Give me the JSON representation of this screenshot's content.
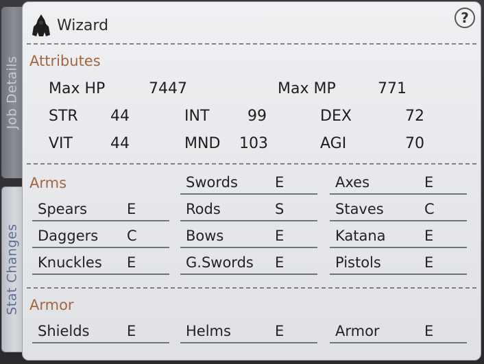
{
  "tabs": {
    "job_details": "Job Details",
    "stat_changes": "Stat Changes"
  },
  "job": {
    "name": "Wizard",
    "icon": "wizard-icon",
    "help": "?"
  },
  "attributes": {
    "title": "Attributes",
    "max_hp_label": "Max HP",
    "max_hp": "7447",
    "max_mp_label": "Max MP",
    "max_mp": "771",
    "str_label": "STR",
    "str": "44",
    "int_label": "INT",
    "int": "99",
    "dex_label": "DEX",
    "dex": "72",
    "vit_label": "VIT",
    "vit": "44",
    "mnd_label": "MND",
    "mnd": "103",
    "agi_label": "AGI",
    "agi": "70"
  },
  "arms": {
    "title": "Arms",
    "items": [
      {
        "name": "Swords",
        "rank": "E"
      },
      {
        "name": "Axes",
        "rank": "E"
      },
      {
        "name": "Spears",
        "rank": "E"
      },
      {
        "name": "Rods",
        "rank": "S"
      },
      {
        "name": "Staves",
        "rank": "C"
      },
      {
        "name": "Daggers",
        "rank": "C"
      },
      {
        "name": "Bows",
        "rank": "E"
      },
      {
        "name": "Katana",
        "rank": "E"
      },
      {
        "name": "Knuckles",
        "rank": "E"
      },
      {
        "name": "G.Swords",
        "rank": "E"
      },
      {
        "name": "Pistols",
        "rank": "E"
      }
    ]
  },
  "armor": {
    "title": "Armor",
    "items": [
      {
        "name": "Shields",
        "rank": "E"
      },
      {
        "name": "Helms",
        "rank": "E"
      },
      {
        "name": "Armor",
        "rank": "E"
      }
    ]
  }
}
